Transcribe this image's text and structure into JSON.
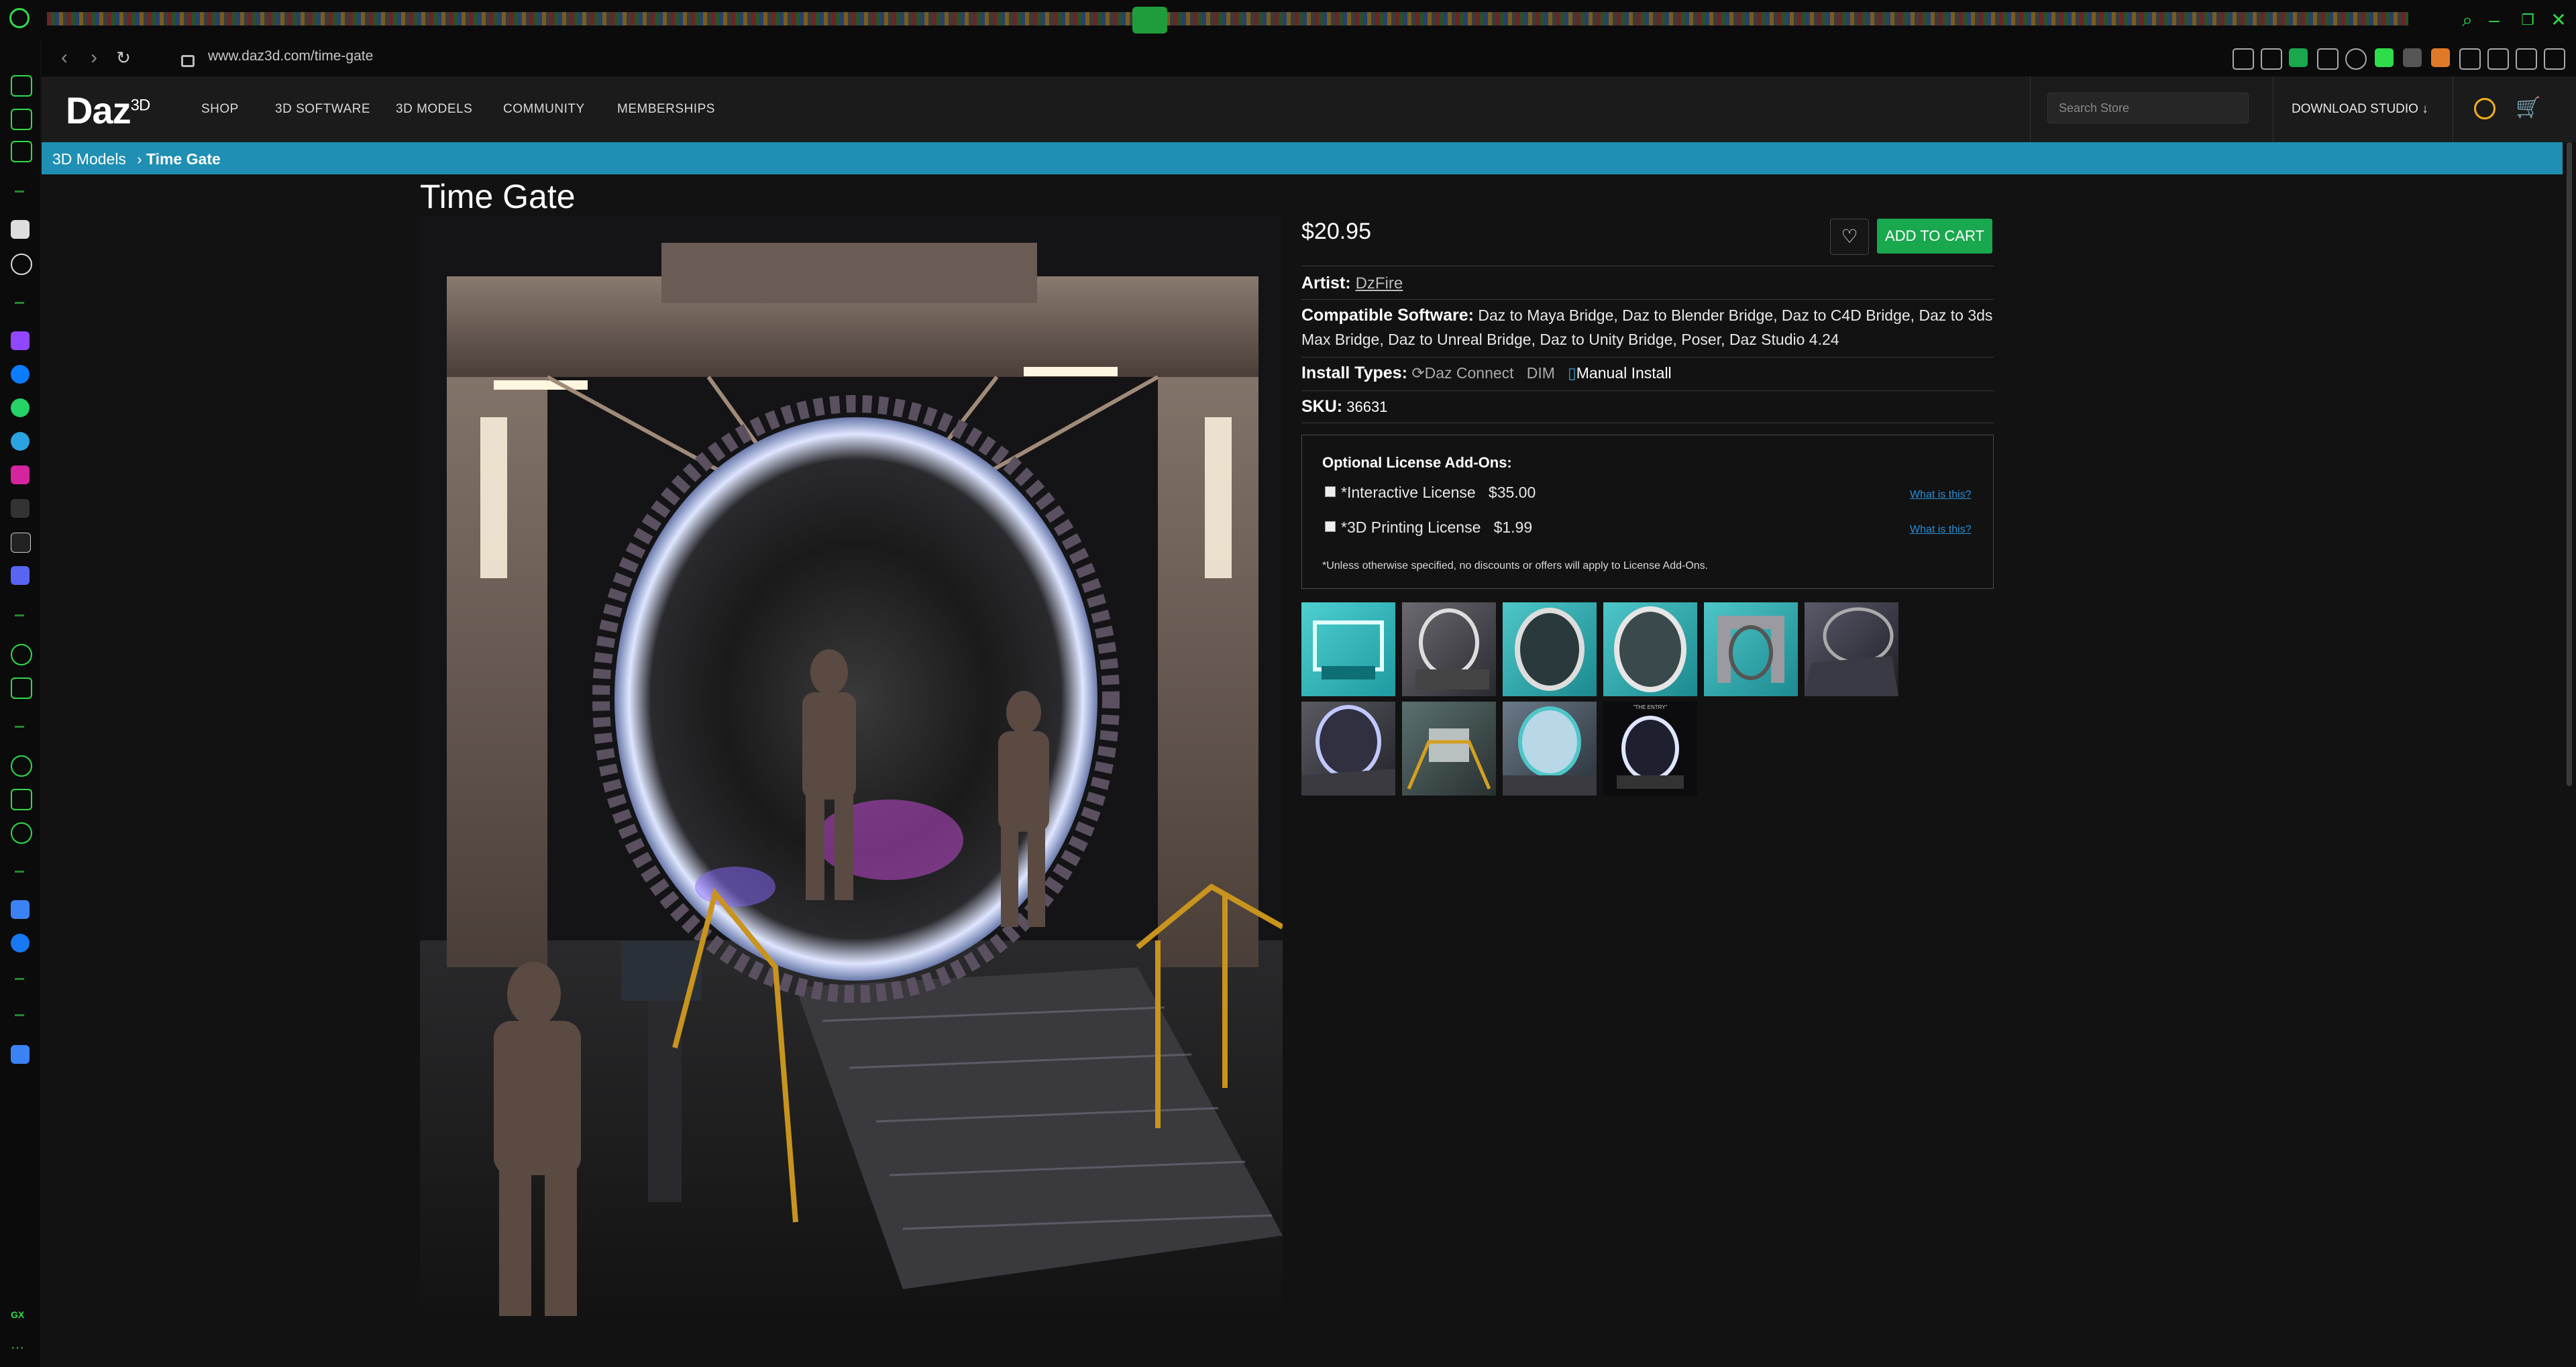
{
  "browser": {
    "url": "www.daz3d.com/time-gate"
  },
  "site": {
    "logo": "Daz",
    "logo_sup": "3D",
    "nav": [
      "SHOP",
      "3D SOFTWARE",
      "3D MODELS",
      "COMMUNITY",
      "MEMBERSHIPS"
    ],
    "search_placeholder": "Search Store",
    "download_studio": "DOWNLOAD STUDIO"
  },
  "breadcrumb": {
    "parent": "3D Models",
    "separator": "›",
    "current": "Time Gate"
  },
  "product": {
    "title": "Time Gate",
    "price": "$20.95",
    "add_to_cart": "ADD TO CART",
    "artist_label": "Artist:",
    "artist": "DzFire",
    "compatible_label": "Compatible Software:",
    "compatible": "Daz to Maya Bridge, Daz to Blender Bridge, Daz to C4D Bridge, Daz to 3ds Max Bridge, Daz to Unreal Bridge, Daz to Unity Bridge, Poser, Daz Studio 4.24",
    "install_label": "Install Types:",
    "install_types": [
      "Daz Connect",
      "DIM",
      "Manual Install"
    ],
    "sku_label": "SKU:",
    "sku": "36631"
  },
  "license": {
    "title": "Optional License Add-Ons:",
    "items": [
      {
        "label": "*Interactive License",
        "price": "$35.00",
        "what": "What is this?"
      },
      {
        "label": "*3D Printing License",
        "price": "$1.99",
        "what": "What is this?"
      }
    ],
    "note": "*Unless otherwise specified, no discounts or offers will apply to License Add-Ons."
  },
  "thumbnails": {
    "count": 10,
    "caption": "\"THE ENTRY\""
  },
  "colors": {
    "accent_green": "#19a84e",
    "breadcrumb_blue": "#1f8fb3",
    "opera_green": "#2fdc4a"
  }
}
